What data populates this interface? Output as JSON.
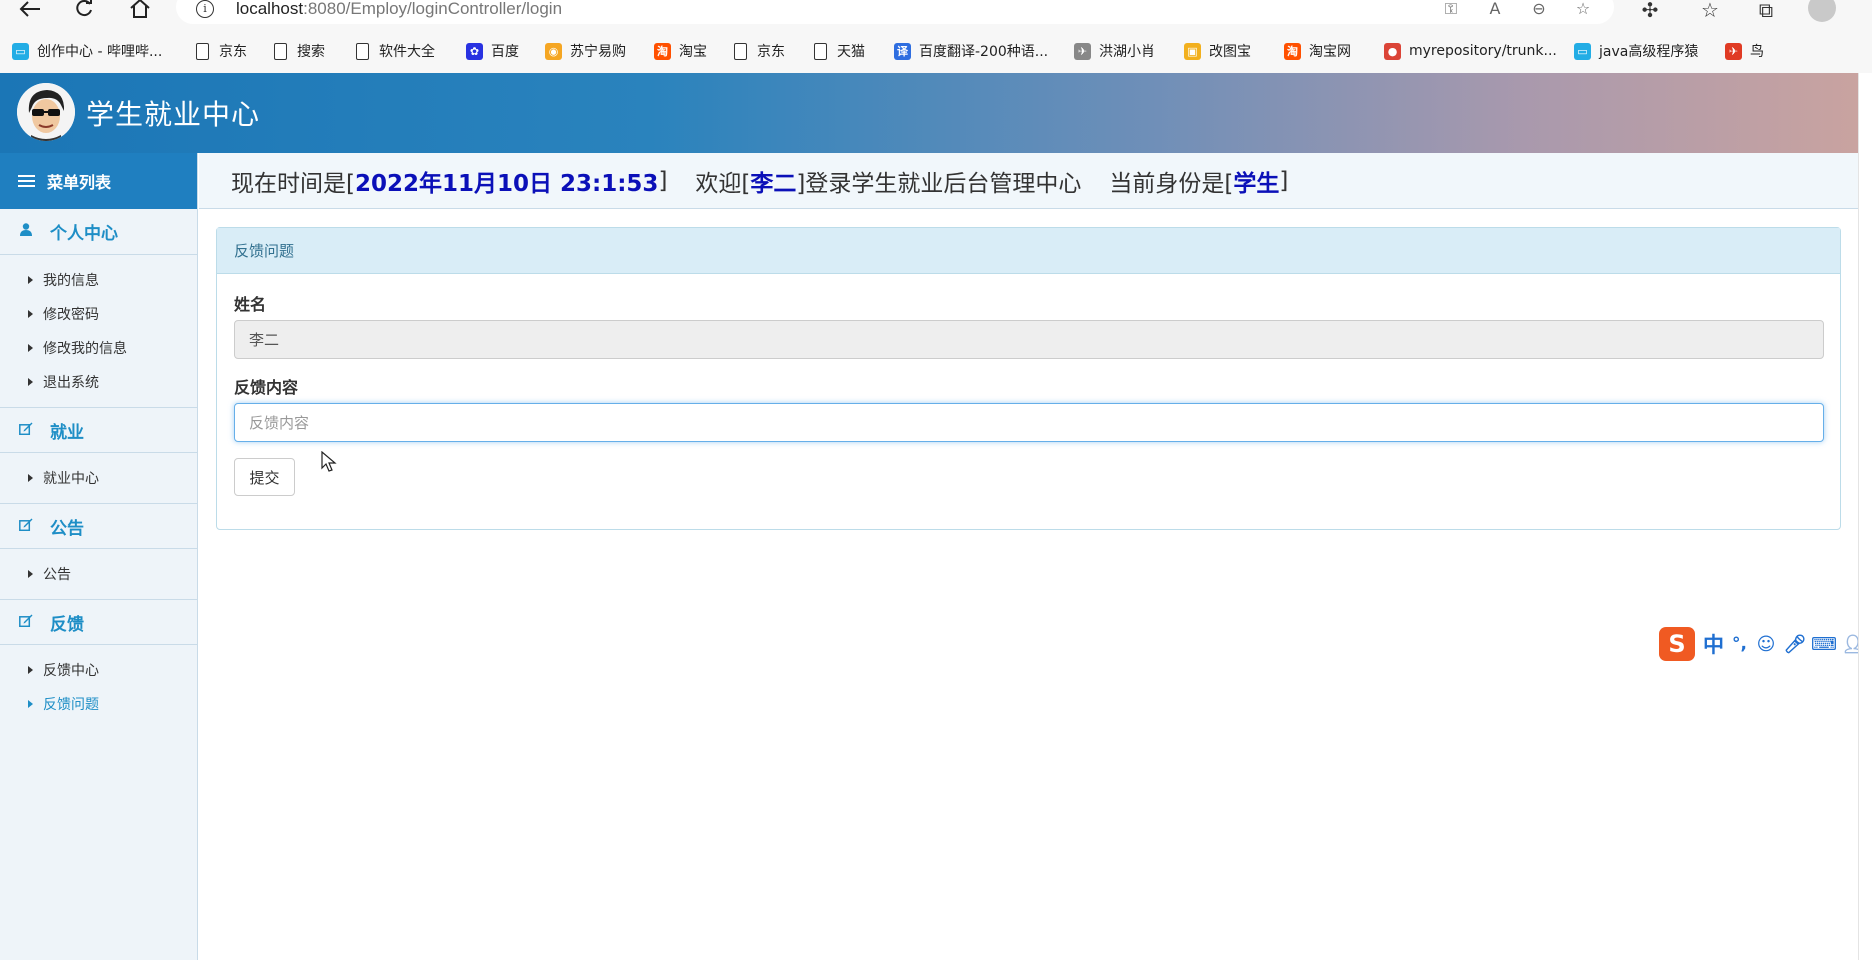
{
  "browser": {
    "url_host": "localhost",
    "url_rest": ":8080/Employ/loginController/login",
    "bookmarks": [
      {
        "label": "创作中心 - 哔哩哔...",
        "icon": "bilibili-icon",
        "color": "#23ade5"
      },
      {
        "label": "京东",
        "icon": "file-icon"
      },
      {
        "label": "搜索",
        "icon": "file-icon"
      },
      {
        "label": "软件大全",
        "icon": "file-icon"
      },
      {
        "label": "百度",
        "icon": "baidu-paw-icon",
        "color": "#2932e1"
      },
      {
        "label": "苏宁易购",
        "icon": "suning-icon",
        "color": "#f5a623"
      },
      {
        "label": "淘宝",
        "icon": "taobao-icon",
        "color": "#ff5000"
      },
      {
        "label": "京东",
        "icon": "file-icon"
      },
      {
        "label": "天猫",
        "icon": "file-icon"
      },
      {
        "label": "百度翻译-200种语...",
        "icon": "baidu-translate-icon",
        "color": "#2f6ee0"
      },
      {
        "label": "洪湖小肖",
        "icon": "bird-icon",
        "color": "#888888"
      },
      {
        "label": "改图宝",
        "icon": "gaitubao-icon",
        "color": "#f2b01e"
      },
      {
        "label": "淘宝网",
        "icon": "taobao-icon",
        "color": "#ff5000"
      },
      {
        "label": "myrepository/trunk...",
        "icon": "chrome-icon",
        "color": "#db4437"
      },
      {
        "label": "java高级程序猿",
        "icon": "bilibili-icon",
        "color": "#23ade5"
      },
      {
        "label": "鸟",
        "icon": "bird-red-icon",
        "color": "#e03b24"
      }
    ]
  },
  "header": {
    "title": "学生就业中心"
  },
  "sidebar": {
    "menu_title": "菜单列表",
    "groups": [
      {
        "label": "个人中心",
        "icon": "user-icon",
        "items": [
          "我的信息",
          "修改密码",
          "修改我的信息",
          "退出系统"
        ]
      },
      {
        "label": "就业",
        "icon": "edit-icon",
        "items": [
          "就业中心"
        ]
      },
      {
        "label": "公告",
        "icon": "edit-icon",
        "items": [
          "公告"
        ]
      },
      {
        "label": "反馈",
        "icon": "edit-icon",
        "items": [
          "反馈中心",
          "反馈问题"
        ]
      }
    ],
    "active_item": "反馈问题"
  },
  "info_bar": {
    "time_prefix": "现在时间是[",
    "time_value": "2022年11月10日 23:1:53",
    "time_suffix": "]",
    "welcome_prefix": "欢迎[",
    "user_name": "李二",
    "welcome_suffix": "]登录学生就业后台管理中心",
    "role_prefix": "当前身份是[",
    "role": "学生",
    "role_suffix": "]"
  },
  "panel": {
    "title": "反馈问题",
    "name_label": "姓名",
    "name_value": "李二",
    "content_label": "反馈内容",
    "content_placeholder": "反馈内容",
    "submit_label": "提交"
  },
  "ime": {
    "mode": "中",
    "punct": "°,"
  },
  "colors": {
    "accent": "#1e8ec6",
    "menu_title_bg": "#1f7fc0",
    "highlight_text": "#0b10b8",
    "panel_head_bg": "#d9edf7"
  }
}
